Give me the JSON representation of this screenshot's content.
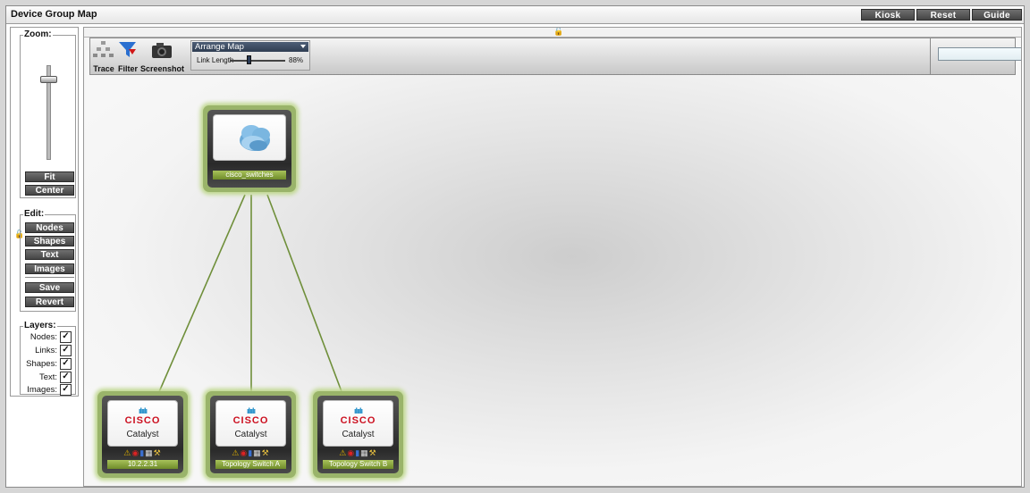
{
  "window": {
    "title": "Device Group Map"
  },
  "top_buttons": {
    "kiosk": "Kiosk",
    "reset": "Reset",
    "guide": "Guide"
  },
  "zoom": {
    "legend": "Zoom:",
    "fit": "Fit",
    "center": "Center",
    "level": 0.15
  },
  "edit": {
    "legend": "Edit:",
    "nodes": "Nodes",
    "shapes": "Shapes",
    "text": "Text",
    "images": "Images",
    "save": "Save",
    "revert": "Revert"
  },
  "layers": {
    "legend": "Layers:",
    "items": [
      {
        "label": "Nodes:",
        "checked": true
      },
      {
        "label": "Links:",
        "checked": true
      },
      {
        "label": "Shapes:",
        "checked": true
      },
      {
        "label": "Text:",
        "checked": true
      },
      {
        "label": "Images:",
        "checked": true
      }
    ]
  },
  "toolbar": {
    "trace": "Trace",
    "filter": "Filter",
    "screenshot": "Screenshot",
    "arrange_select": "Arrange Map",
    "link_length_label": "Link Length",
    "link_length_value": "88%",
    "search_value": ""
  },
  "nodes": {
    "group": {
      "label": "cisco_switches",
      "icon": "cloud-icon"
    },
    "devices": [
      {
        "label": "10.2.2.31",
        "brand": "CISCO",
        "model": "Catalyst"
      },
      {
        "label": "Topology Switch A",
        "brand": "CISCO",
        "model": "Catalyst"
      },
      {
        "label": "Topology Switch B",
        "brand": "CISCO",
        "model": "Catalyst"
      }
    ],
    "status_icons": [
      "warning-icon",
      "lifebuoy-icon",
      "bar-chart-icon",
      "printer-icon",
      "wrench-icon"
    ]
  },
  "colors": {
    "link": "#6f8f3a",
    "node_glow": "#c0d890",
    "label_green": "#7d9a35",
    "cisco_red": "#cc1020",
    "cisco_blue": "#1a8ac7"
  }
}
